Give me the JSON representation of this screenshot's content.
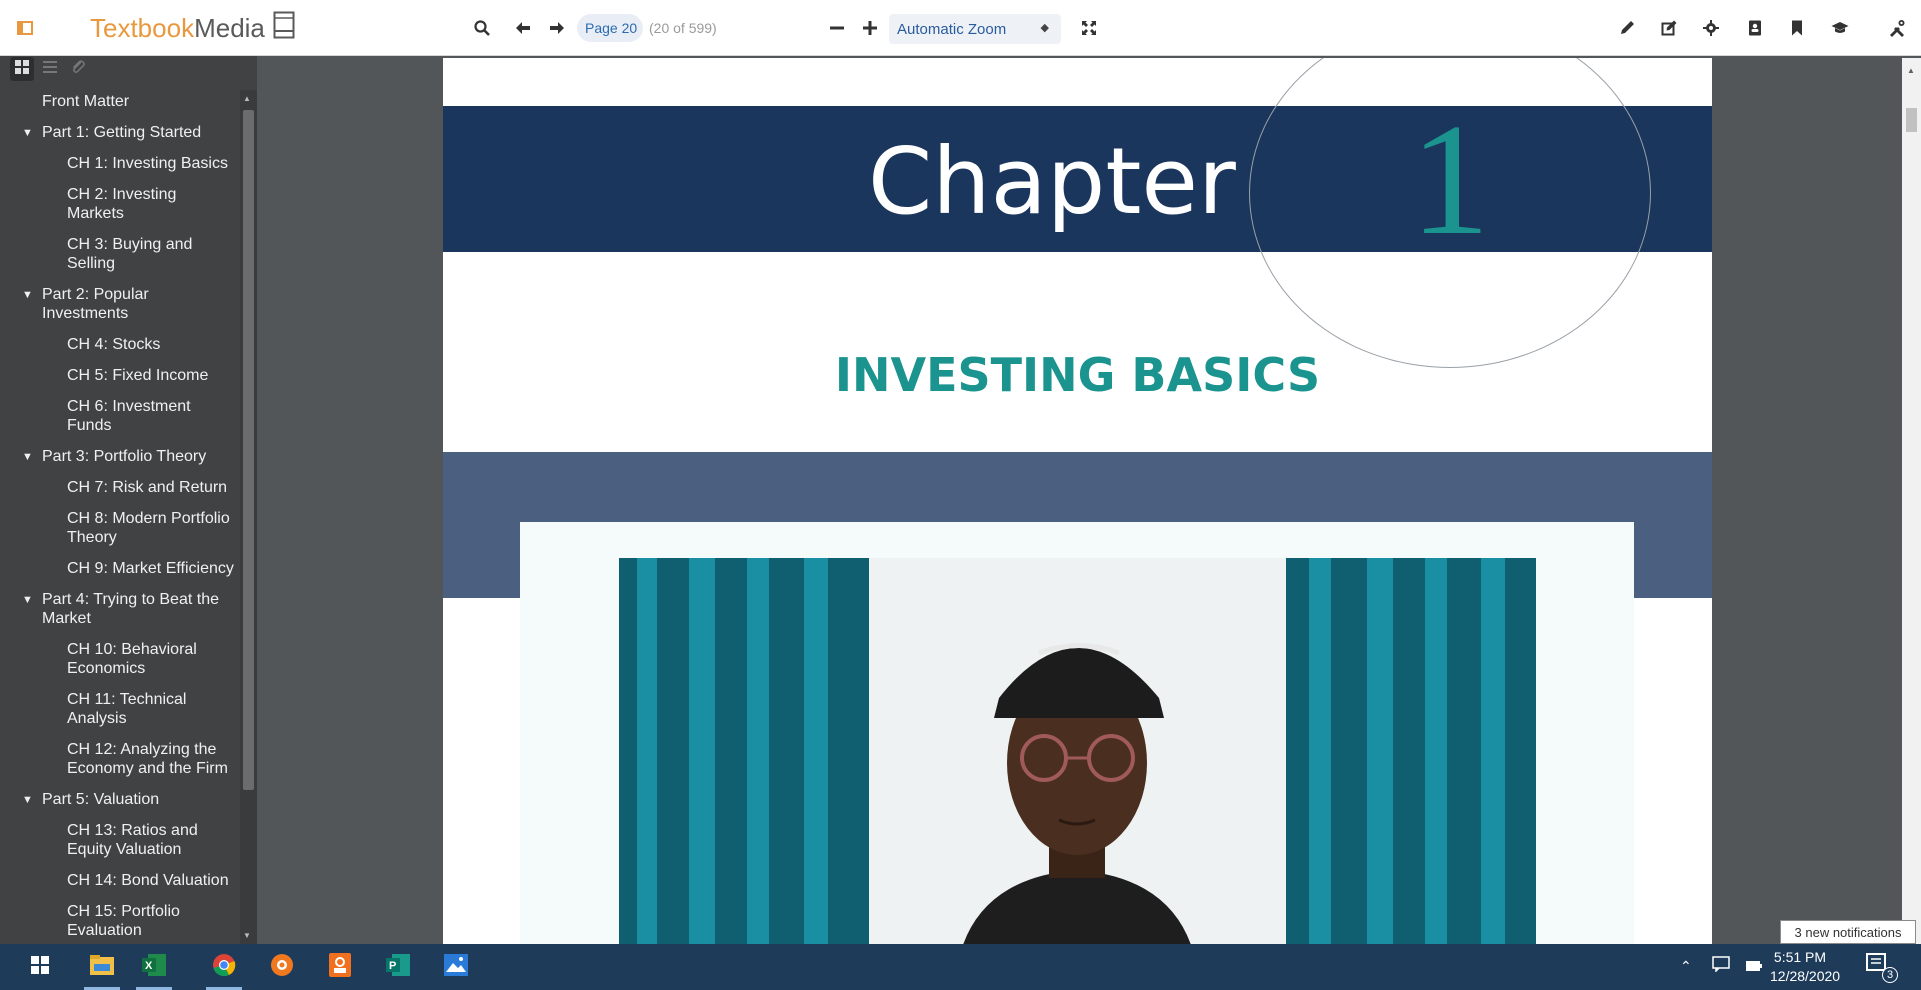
{
  "toolbar": {
    "logo_text_1": "Textbook",
    "logo_text_2": "Media",
    "page_value": "Page 20",
    "page_count": "(20 of 599)",
    "zoom_selected": "Automatic Zoom"
  },
  "icons": {
    "sidebar_toggle": "sidebar-toggle-icon",
    "search": "search-icon",
    "prev": "arrow-left-icon",
    "next": "arrow-right-icon",
    "zoom_out": "minus-icon",
    "zoom_in": "plus-icon",
    "fullscreen": "expand-icon",
    "pen": "pen-icon",
    "edit": "edit-icon",
    "settings": "gear-icon",
    "contacts": "contact-book-icon",
    "bookmark": "bookmark-icon",
    "cap": "graduation-cap-icon",
    "tools": "tools-icon"
  },
  "sidebar": {
    "outline": [
      {
        "type": "item",
        "label": "Front Matter"
      },
      {
        "type": "part",
        "label": "Part 1: Getting Started"
      },
      {
        "type": "chapter",
        "label": "CH 1: Investing Basics"
      },
      {
        "type": "chapter",
        "label": "CH 2: Investing Markets"
      },
      {
        "type": "chapter",
        "label": "CH 3: Buying and Selling"
      },
      {
        "type": "part",
        "label": "Part 2: Popular Investments"
      },
      {
        "type": "chapter",
        "label": "CH 4: Stocks"
      },
      {
        "type": "chapter",
        "label": "CH 5: Fixed Income"
      },
      {
        "type": "chapter",
        "label": "CH 6: Investment Funds"
      },
      {
        "type": "part",
        "label": "Part 3: Portfolio Theory"
      },
      {
        "type": "chapter",
        "label": "CH 7: Risk and Return"
      },
      {
        "type": "chapter",
        "label": "CH 8: Modern Portfolio Theory"
      },
      {
        "type": "chapter",
        "label": "CH 9: Market Efficiency"
      },
      {
        "type": "part",
        "label": "Part 4: Trying to Beat the Market"
      },
      {
        "type": "chapter",
        "label": "CH 10: Behavioral Economics"
      },
      {
        "type": "chapter",
        "label": "CH 11: Technical Analysis"
      },
      {
        "type": "chapter",
        "label": "CH 12: Analyzing the Economy and the Firm"
      },
      {
        "type": "part",
        "label": "Part 5: Valuation"
      },
      {
        "type": "chapter",
        "label": "CH 13: Ratios and Equity Valuation"
      },
      {
        "type": "chapter",
        "label": "CH 14: Bond Valuation"
      },
      {
        "type": "chapter",
        "label": "CH 15: Portfolio Evaluation"
      }
    ]
  },
  "page": {
    "chapter_word": "Chapter",
    "chapter_number": "1",
    "chapter_title": "INVESTING BASICS",
    "colors": {
      "navy": "#1b365d",
      "teal": "#1b938e",
      "slate": "#4b5f80"
    }
  },
  "notification": {
    "text": "3 new notifications"
  },
  "taskbar": {
    "time": "5:51 PM",
    "date": "12/28/2020",
    "notification_count": "3",
    "apps": [
      "start-icon",
      "file-explorer-icon",
      "excel-icon",
      "chrome-icon",
      "app-orange-icon",
      "app-orange-2-icon",
      "publisher-icon",
      "photos-icon"
    ]
  }
}
